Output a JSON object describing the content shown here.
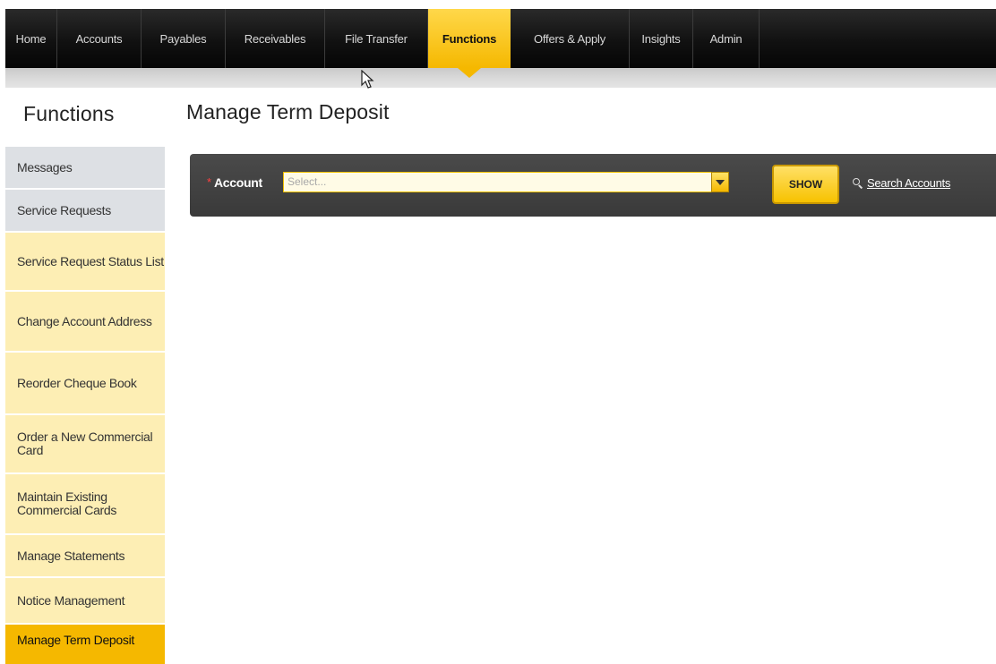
{
  "nav": {
    "items": [
      {
        "label": "Home"
      },
      {
        "label": "Accounts"
      },
      {
        "label": "Payables"
      },
      {
        "label": "Receivables"
      },
      {
        "label": "File Transfer"
      },
      {
        "label": "Functions",
        "active": true
      },
      {
        "label": "Offers & Apply"
      },
      {
        "label": "Insights"
      },
      {
        "label": "Admin"
      }
    ]
  },
  "sidebar": {
    "heading": "Functions",
    "items": [
      {
        "label": "Messages",
        "style": "grey"
      },
      {
        "label": "Service Requests",
        "style": "grey"
      },
      {
        "label": "Service Request Status List",
        "style": "yellow"
      },
      {
        "label": "Change Account Address",
        "style": "yellow"
      },
      {
        "label": "Reorder Cheque Book",
        "style": "yellow"
      },
      {
        "label": "Order a New Commercial Card",
        "style": "yellow"
      },
      {
        "label": "Maintain Existing Commercial Cards",
        "style": "yellow"
      },
      {
        "label": "Manage Statements",
        "style": "yellow"
      },
      {
        "label": "Notice Management",
        "style": "yellow"
      },
      {
        "label": "Manage Term Deposit",
        "style": "active"
      }
    ]
  },
  "main": {
    "title": "Manage Term Deposit",
    "filter": {
      "required_mark": "*",
      "account_label": "Account",
      "account_placeholder": "Select...",
      "show_label": "SHOW",
      "search_link": "Search Accounts"
    }
  },
  "colors": {
    "nav_bg": "#111111",
    "accent": "#f5b800",
    "sidebar_grey": "#dde0e4",
    "sidebar_yellow": "#fdeeb4",
    "filterbar_bg": "#3f3f3f"
  }
}
